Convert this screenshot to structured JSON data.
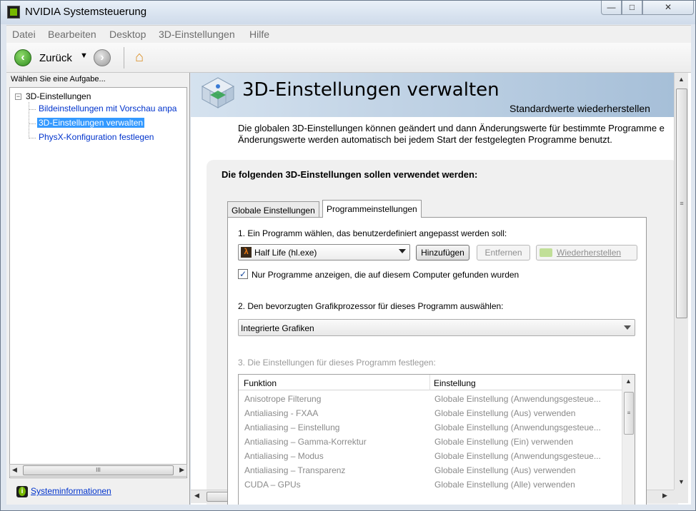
{
  "window": {
    "title": "NVIDIA Systemsteuerung",
    "controls": {
      "minimize": "—",
      "maximize": "□",
      "close": "✕"
    }
  },
  "menu": [
    "Datei",
    "Bearbeiten",
    "Desktop",
    "3D-Einstellungen",
    "Hilfe"
  ],
  "toolbar": {
    "back_label": "Zurück",
    "back_icon": "arrow-left-icon",
    "forward_icon": "arrow-right-icon",
    "home_icon": "home-icon"
  },
  "sidebar": {
    "task_prompt": "Wählen Sie eine Aufgabe...",
    "root": "3D-Einstellungen",
    "expander": "−",
    "items": [
      "Bildeinstellungen mit Vorschau anpa",
      "3D-Einstellungen verwalten",
      "PhysX-Konfiguration festlegen"
    ],
    "selected_index": 1,
    "system_info": "Systeminformationen"
  },
  "main": {
    "title": "3D-Einstellungen verwalten",
    "restore_defaults": "Standardwerte wiederherstellen",
    "description": [
      "Die globalen 3D-Einstellungen können geändert und dann Änderungswerte für bestimmte Programme e",
      "Änderungswerte werden automatisch bei jedem Start der festgelegten Programme benutzt."
    ],
    "settings_heading": "Die folgenden 3D-Einstellungen sollen verwendet werden:",
    "tabs": [
      "Globale Einstellungen",
      "Programmeinstellungen"
    ],
    "active_tab": 1,
    "step1": "1. Ein Programm wählen, das benutzerdefiniert angepasst werden soll:",
    "program_selected": "Half Life (hl.exe)",
    "program_icon_glyph": "λ",
    "buttons": {
      "add": "Hinzufügen",
      "remove": "Entfernen",
      "restore": "Wiederherstellen"
    },
    "only_programs_checked": true,
    "check_glyph": "✓",
    "only_programs_label": "Nur Programme anzeigen, die auf diesem Computer gefunden wurden",
    "step2": "2. Den bevorzugten Grafikprozessor für dieses Programm auswählen:",
    "gpu_selected": "Integrierte Grafiken",
    "step3": "3. Die Einstellungen für dieses Programm festlegen:",
    "table": {
      "headers": [
        "Funktion",
        "Einstellung"
      ],
      "rows": [
        [
          "Anisotrope Filterung",
          "Globale Einstellung (Anwendungsgesteue..."
        ],
        [
          "Antialiasing - FXAA",
          "Globale Einstellung (Aus) verwenden"
        ],
        [
          "Antialiasing – Einstellung",
          "Globale Einstellung (Anwendungsgesteue..."
        ],
        [
          "Antialiasing – Gamma-Korrektur",
          "Globale Einstellung (Ein) verwenden"
        ],
        [
          "Antialiasing – Modus",
          "Globale Einstellung (Anwendungsgesteue..."
        ],
        [
          "Antialiasing – Transparenz",
          "Globale Einstellung (Aus) verwenden"
        ],
        [
          "CUDA – GPUs",
          "Globale Einstellung (Alle) verwenden"
        ]
      ]
    }
  },
  "scroll_glyphs": {
    "left": "◀",
    "right": "▶",
    "up": "▲",
    "down": "▼",
    "grip_h": "III",
    "grip_v": "≡"
  },
  "colors": {
    "nvidia_green": "#76b900",
    "selection": "#3399ff",
    "header_band": "#a6bfd8"
  }
}
